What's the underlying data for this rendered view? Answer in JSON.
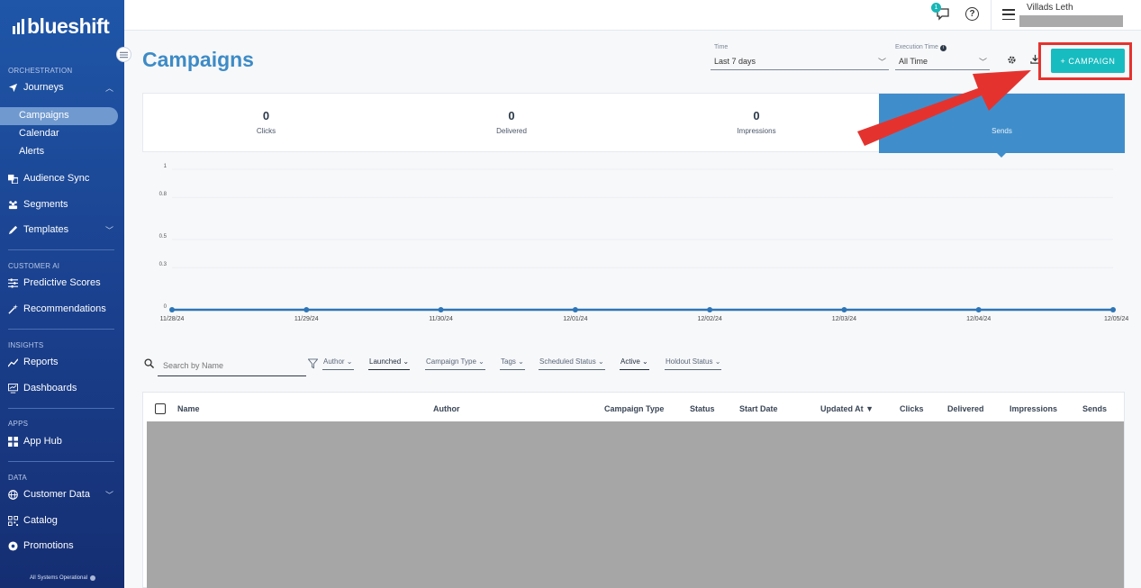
{
  "brand": {
    "logo_text": "blueshift"
  },
  "sidebar": {
    "orchestration_label": "ORCHESTRATION",
    "journeys": "Journeys",
    "campaigns": "Campaigns",
    "calendar": "Calendar",
    "alerts": "Alerts",
    "audience_sync": "Audience Sync",
    "segments": "Segments",
    "templates": "Templates",
    "customer_ai_label": "CUSTOMER AI",
    "predictive_scores": "Predictive Scores",
    "recommendations": "Recommendations",
    "insights_label": "INSIGHTS",
    "reports": "Reports",
    "dashboards": "Dashboards",
    "apps_label": "APPS",
    "app_hub": "App Hub",
    "data_label": "DATA",
    "customer_data": "Customer Data",
    "catalog": "Catalog",
    "promotions": "Promotions",
    "status": "All Systems Operational"
  },
  "topbar": {
    "notification_count": "1",
    "user_name": "Villads Leth"
  },
  "header": {
    "title": "Campaigns",
    "time_label": "Time",
    "time_value": "Last 7 days",
    "exec_label": "Execution Time",
    "exec_value": "All Time",
    "campaign_button": "+ CAMPAIGN"
  },
  "stats": [
    {
      "value": "0",
      "label": "Clicks"
    },
    {
      "value": "0",
      "label": "Delivered"
    },
    {
      "value": "0",
      "label": "Impressions"
    },
    {
      "value": "",
      "label": "Sends"
    }
  ],
  "chart_data": {
    "type": "line",
    "x": [
      "11/28/24",
      "11/29/24",
      "11/30/24",
      "12/01/24",
      "12/02/24",
      "12/03/24",
      "12/04/24",
      "12/05/24"
    ],
    "series": [
      {
        "values": [
          0,
          0,
          0,
          0,
          0,
          0,
          0,
          0
        ]
      }
    ],
    "y_ticks": [
      "1",
      "0.8",
      "0.5",
      "0.3",
      "0"
    ],
    "ylim": [
      0,
      1
    ],
    "grid": true,
    "color": "#2e75b6"
  },
  "filters": {
    "search_placeholder": "Search by Name",
    "chips": [
      "Author",
      "Launched",
      "Campaign Type",
      "Tags",
      "Scheduled Status",
      "Active",
      "Holdout Status"
    ]
  },
  "table": {
    "columns": [
      "Name",
      "Author",
      "Campaign Type",
      "Status",
      "Start Date",
      "Updated At ▼",
      "Clicks",
      "Delivered",
      "Impressions",
      "Sends"
    ]
  },
  "colors": {
    "accent": "#17bcc0",
    "brand_blue": "#3d8bc6",
    "highlight": "#e4332f"
  }
}
